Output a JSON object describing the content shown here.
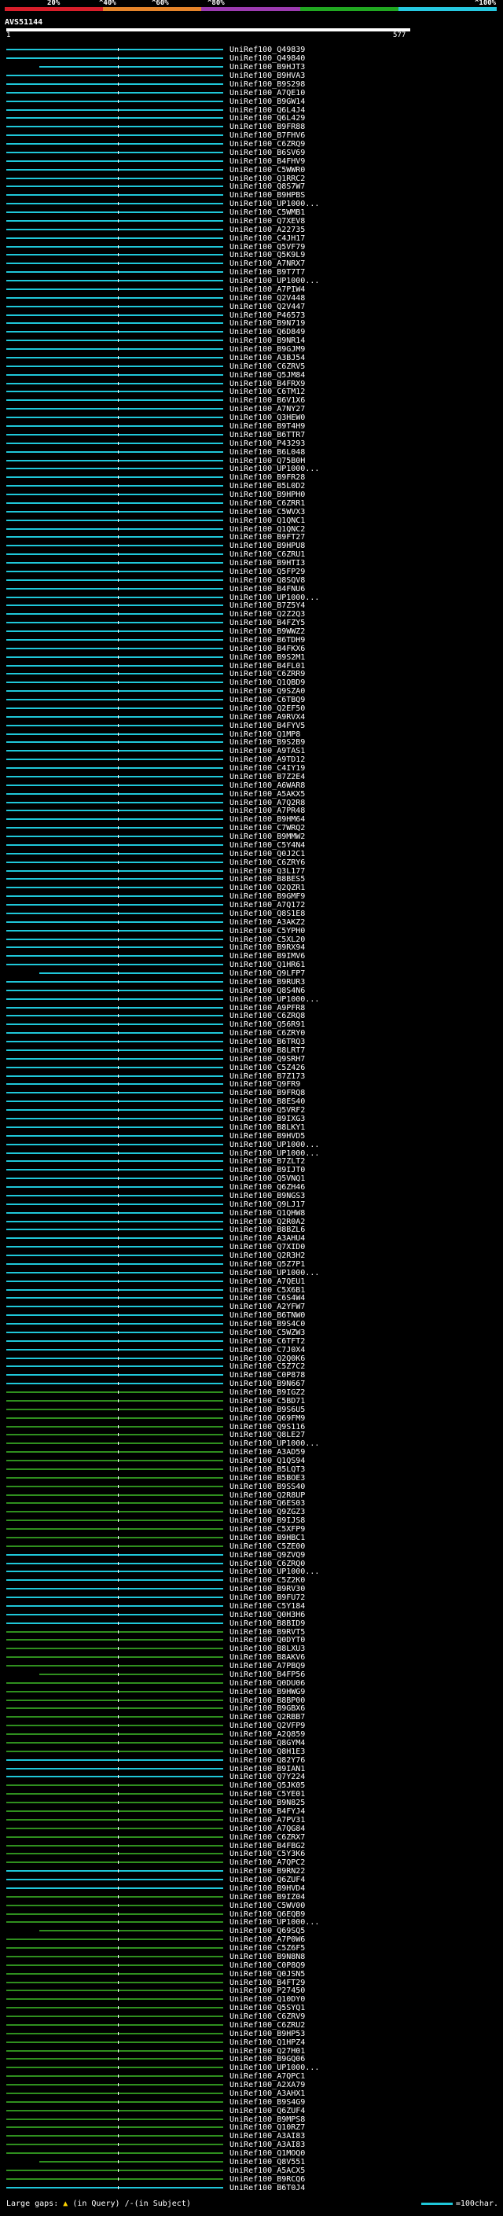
{
  "query_id": "AVS51144",
  "scale_labels": [
    "20%",
    "^40%",
    "^60%",
    "^80%",
    "^100%"
  ],
  "scale_colors": [
    "#d81e2a",
    "#e5842a",
    "#9c3bb0",
    "#21a821",
    "#26c8e0"
  ],
  "axis": {
    "start": "1",
    "end": "577",
    "max": 577
  },
  "colors": {
    "hit_high": "#1fc7d9",
    "hit_mid": "#2f8f1e",
    "gap_bar": "#000000",
    "label": "#ffffff",
    "tick": "#ffffff"
  },
  "footer": {
    "gaps_label": "Large gaps:",
    "gaps_in_query": "(in Query)",
    "gaps_in_subject": "/-(in Subject)",
    "scale_note": "=100char."
  },
  "hits": [
    "UniRef100_Q49839",
    "UniRef100_Q49840",
    "UniRef100_B9HJT3",
    "UniRef100_B9HVA3",
    "UniRef100_B9S298",
    "UniRef100_A7QE10",
    "UniRef100_B9GW14",
    "UniRef100_Q6L4J4",
    "UniRef100_Q6L429",
    "UniRef100_B9FR88",
    "UniRef100_B7FHV6",
    "UniRef100_C6ZRQ9",
    "UniRef100_B6SV69",
    "UniRef100_B4FHV9",
    "UniRef100_C5WWR0",
    "UniRef100_Q1RRC2",
    "UniRef100_Q8S7W7",
    "UniRef100_B9HPBS",
    "UniRef100_UP1000...",
    "UniRef100_C5WMB1",
    "UniRef100_Q7XEV8",
    "UniRef100_A22735",
    "UniRef100_C4JH17",
    "UniRef100_Q5VF79",
    "UniRef100_Q5K9L9",
    "UniRef100_A7NRX7",
    "UniRef100_B9T7T7",
    "UniRef100_UP1000...",
    "UniRef100_A7PIW4",
    "UniRef100_Q2V448",
    "UniRef100_Q2V447",
    "UniRef100_P46573",
    "UniRef100_B9N719",
    "UniRef100_Q6D849",
    "UniRef100_B9NR14",
    "UniRef100_B9GJM9",
    "UniRef100_A3BJ54",
    "UniRef100_C6ZRV5",
    "UniRef100_Q5JM84",
    "UniRef100_B4FRX9",
    "UniRef100_C6TM12",
    "UniRef100_B6V1X6",
    "UniRef100_A7NY27",
    "UniRef100_Q3HEW0",
    "UniRef100_B9T4H9",
    "UniRef100_B6TTR7",
    "UniRef100_P43293",
    "UniRef100_B6L048",
    "UniRef100_Q75B0H",
    "UniRef100_UP1000...",
    "UniRef100_B9FR28",
    "UniRef100_B5L0D2",
    "UniRef100_B9HPH0",
    "UniRef100_C6ZRR1",
    "UniRef100_C5WVX3",
    "UniRef100_Q1QNC1",
    "UniRef100_Q1QNC2",
    "UniRef100_B9FT27",
    "UniRef100_B9HPU8",
    "UniRef100_C6ZRU1",
    "UniRef100_B9HTI3",
    "UniRef100_Q5FP29",
    "UniRef100_Q8SQV8",
    "UniRef100_B4FNU6",
    "UniRef100_UP1000...",
    "UniRef100_B7Z5Y4",
    "UniRef100_Q2Z2Q3",
    "UniRef100_B4FZY5",
    "UniRef100_B9WWZ2",
    "UniRef100_B6TDH9",
    "UniRef100_B4FKX6",
    "UniRef100_B9S2M1",
    "UniRef100_B4FL01",
    "UniRef100_C6ZRR9",
    "UniRef100_Q1QBD9",
    "UniRef100_Q9SZA0",
    "UniRef100_C6TBQ9",
    "UniRef100_Q2EF50",
    "UniRef100_A9RVX4",
    "UniRef100_B4FYV5",
    "UniRef100_Q1MP8",
    "UniRef100_B9S2B9",
    "UniRef100_A9TAS1",
    "UniRef100_A9TD12",
    "UniRef100_C4IY19",
    "UniRef100_B7Z2E4",
    "UniRef100_A6WAR8",
    "UniRef100_A5AKX5",
    "UniRef100_A7Q2R8",
    "UniRef100_A7PR48",
    "UniRef100_B9HM64",
    "UniRef100_C7WRQ2",
    "UniRef100_B9MMW2",
    "UniRef100_C5Y4N4",
    "UniRef100_Q0J2C1",
    "UniRef100_C6ZRY6",
    "UniRef100_Q3L177",
    "UniRef100_B8BES5",
    "UniRef100_Q2QZR1",
    "UniRef100_B9GMF9",
    "UniRef100_A7Q172",
    "UniRef100_Q8S1E8",
    "UniRef100_A3AKZ2",
    "UniRef100_C5YPH0",
    "UniRef100_C5XL20",
    "UniRef100_B9RX94",
    "UniRef100_B9IMV6",
    "UniRef100_Q1HR61",
    "UniRef100_Q9LFP7",
    "UniRef100_B9RUR3",
    "UniRef100_Q8S4N6",
    "UniRef100_UP1000...",
    "UniRef100_A9PFR8",
    "UniRef100_C6ZRQ8",
    "UniRef100_Q56R91",
    "UniRef100_C6ZRY0",
    "UniRef100_B6TRQ3",
    "UniRef100_B8LRT7",
    "UniRef100_Q9SRH7",
    "UniRef100_C5Z426",
    "UniRef100_B7Z173",
    "UniRef100_Q9FR9",
    "UniRef100_B9FRQ8",
    "UniRef100_B8ES40",
    "UniRef100_Q5VRF2",
    "UniRef100_B9IXG3",
    "UniRef100_B8LKY1",
    "UniRef100_B9HVD5",
    "UniRef100_UP1000...",
    "UniRef100_UP1000...",
    "UniRef100_B7ZLT2",
    "UniRef100_B9IJT0",
    "UniRef100_Q5VNQ1",
    "UniRef100_Q6ZH46",
    "UniRef100_B9NGS3",
    "UniRef100_Q9LJ17",
    "UniRef100_Q1QHW8",
    "UniRef100_Q2R0A2",
    "UniRef100_B8BZL6",
    "UniRef100_A3AHU4",
    "UniRef100_Q7XID0",
    "UniRef100_Q2R3H2",
    "UniRef100_Q5Z7P1",
    "UniRef100_UP1000...",
    "UniRef100_A7QEU1",
    "UniRef100_C5X6B1",
    "UniRef100_C6S4W4",
    "UniRef100_A2YFW7",
    "UniRef100_B6TNW0",
    "UniRef100_B9S4C0",
    "UniRef100_C5WZW3",
    "UniRef100_C6TFT2",
    "UniRef100_C7J0X4",
    "UniRef100_Q2Q0K6",
    "UniRef100_C5Z7C2",
    "UniRef100_C0P878",
    "UniRef100_B9N667",
    "UniRef100_B9IGZ2",
    "UniRef100_C5BD71",
    "UniRef100_B9S6U5",
    "UniRef100_Q69FM9",
    "UniRef100_Q9S116",
    "UniRef100_Q8LE27",
    "UniRef100_UP1000...",
    "UniRef100_A3AD59",
    "UniRef100_Q1QS94",
    "UniRef100_B5LQT3",
    "UniRef100_B5BOE3",
    "UniRef100_B9SS40",
    "UniRef100_Q2R8UP",
    "UniRef100_Q6ES03",
    "UniRef100_Q9ZGZ3",
    "UniRef100_B9IJS8",
    "UniRef100_C5XFP9",
    "UniRef100_B9HBC1",
    "UniRef100_C5ZE00",
    "UniRef100_Q9ZVQ9",
    "UniRef100_C6ZRQ0",
    "UniRef100_UP1000...",
    "UniRef100_C5Z2K0",
    "UniRef100_B9RV30",
    "UniRef100_B9FU72",
    "UniRef100_C5Y184",
    "UniRef100_Q0H3H6",
    "UniRef100_B8BID9",
    "UniRef100_B9RVT5",
    "UniRef100_Q0DYT0",
    "UniRef100_B8LXU3",
    "UniRef100_B8AKV6",
    "UniRef100_A7PBQ9",
    "UniRef100_B4FP56",
    "UniRef100_Q0DU06",
    "UniRef100_B9HWG9",
    "UniRef100_B8BP00",
    "UniRef100_B9GBX6",
    "UniRef100_Q2RBB7",
    "UniRef100_Q2VFP9",
    "UniRef100_A2Q859",
    "UniRef100_Q8GYM4",
    "UniRef100_Q8H1E3",
    "UniRef100_Q82Y76",
    "UniRef100_B9IAN1",
    "UniRef100_Q7Y224",
    "UniRef100_Q5JK05",
    "UniRef100_C5YE01",
    "UniRef100_B9N825",
    "UniRef100_B4FYJ4",
    "UniRef100_A7PV31",
    "UniRef100_A7QG84",
    "UniRef100_C6ZRX7",
    "UniRef100_B4FBG2",
    "UniRef100_C5Y3K6",
    "UniRef100_A7QPC2",
    "UniRef100_B9RN22",
    "UniRef100_Q6ZUF4",
    "UniRef100_B9HVD4",
    "UniRef100_B9IZ04",
    "UniRef100_C5WV00",
    "UniRef100_Q6EQB9",
    "UniRef100_UP1000...",
    "UniRef100_Q69SQ5",
    "UniRef100_A7P0W6",
    "UniRef100_C5Z6F5",
    "UniRef100_B9N8N8",
    "UniRef100_C0P8Q9",
    "UniRef100_Q0JSN5",
    "UniRef100_B4FT29",
    "UniRef100_P27450",
    "UniRef100_Q10DY0",
    "UniRef100_Q5SYQ1",
    "UniRef100_C6ZRV9",
    "UniRef100_C6ZRU2",
    "UniRef100_B9HP53",
    "UniRef100_Q1HPZ4",
    "UniRef100_Q27H01",
    "UniRef100_B9GQ06",
    "UniRef100_UP1000...",
    "UniRef100_A7QPC1",
    "UniRef100_A2XA79",
    "UniRef100_A3AHX1",
    "UniRef100_B9S4G9",
    "UniRef100_Q6ZUF4",
    "UniRef100_B9MPS8",
    "UniRef100_Q10RZ7",
    "UniRef100_A3AI83",
    "UniRef100_A3AI83",
    "UniRef100_Q1MOQ0",
    "UniRef100_Q8V551",
    "UniRef100_A5ACX5",
    "UniRef100_B9RCQ6",
    "UniRef100_B6T0J4"
  ],
  "hits_green_ranges": [
    [
      157,
      175
    ],
    [
      185,
      199
    ],
    [
      203,
      212
    ],
    [
      216,
      249
    ],
    [
      259,
      266
    ],
    [
      276,
      289
    ]
  ],
  "hits_long_black": [
    2,
    108,
    190,
    220,
    247
  ]
}
